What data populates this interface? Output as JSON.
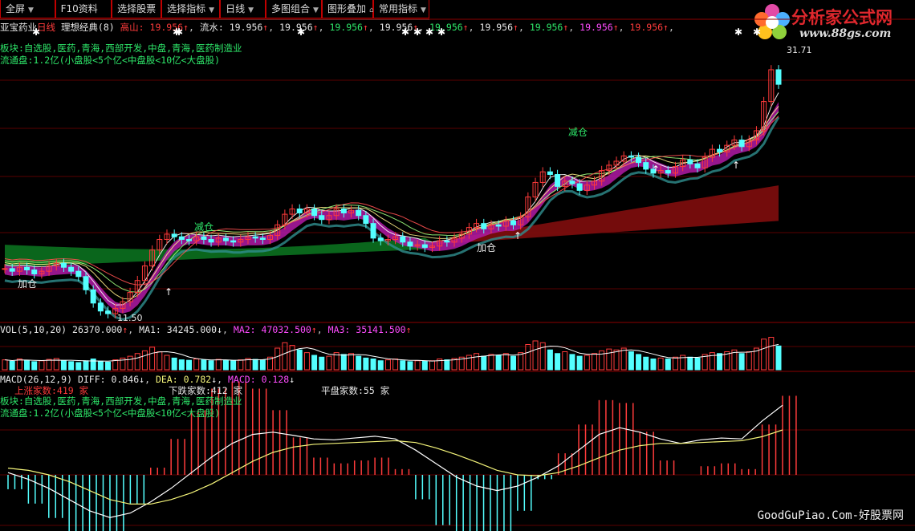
{
  "toolbar": {
    "buttons": [
      "全屏",
      "F10资料",
      "选择股票",
      "选择指标",
      "日线",
      "多图组合",
      "图形叠加",
      "常用指标"
    ]
  },
  "logo": {
    "name": "分析家公式网",
    "url": "www.88gs.com"
  },
  "header": {
    "stock": "亚宝药业",
    "period": "日线",
    "indicator": "理想经典(8)",
    "gaoshan_label": "高山:",
    "gaoshan_value": "19.956",
    "liushui_label": "流水:",
    "liushui_value": "19.956",
    "repeat_value": "19.956"
  },
  "info": {
    "bankuai": "板块:自选股,医药,青海,西部开发,中盘,青海,医药制造业",
    "liutong": "流通盘:1.2亿(小盘股<5个亿<中盘股<10亿<大盘股)"
  },
  "annotations": {
    "jiacang": "加仓",
    "jiancang": "减仓",
    "high_price": "31.71",
    "low_price": "11.50"
  },
  "vol_panel": {
    "label": "VOL(5,10,20)",
    "vol": "26370.000",
    "ma1_label": "MA1:",
    "ma1": "34245.000",
    "ma2_label": "MA2:",
    "ma2": "47032.500",
    "ma3_label": "MA3:",
    "ma3": "35141.500"
  },
  "macd_panel": {
    "label": "MACD(26,12,9)",
    "diff_label": "DIFF:",
    "diff": "0.846",
    "dea_label": "DEA:",
    "dea": "0.782",
    "macd_label": "MACD:",
    "macd": "0.128",
    "up_count": "上涨家数:419 家",
    "down_count": "下跌家数:412 家",
    "flat_count": "平盘家数:55 家"
  },
  "footer": "GoodGuPiao.Com-好股票网",
  "colors": {
    "up": "#ff3b3b",
    "down": "#54ffff",
    "ribbon_purple": "#b01aa6",
    "cloud_green": "#0b6b1e",
    "cloud_red": "#7a0d0d",
    "panel_line": "#8b0000"
  },
  "chart_data": {
    "type": "candlestick",
    "price_range": [
      11.5,
      31.71
    ],
    "high": 31.71,
    "low": 11.5,
    "close": [
      15.2,
      15.0,
      15.3,
      15.1,
      14.8,
      15.0,
      15.4,
      15.6,
      15.3,
      15.0,
      14.6,
      13.6,
      12.6,
      12.0,
      11.8,
      12.2,
      12.7,
      13.4,
      14.3,
      15.4,
      16.6,
      17.4,
      17.8,
      17.6,
      17.4,
      17.3,
      17.6,
      17.4,
      17.2,
      17.5,
      17.3,
      17.2,
      17.4,
      17.6,
      17.5,
      17.4,
      17.7,
      18.5,
      19.3,
      19.7,
      19.4,
      19.7,
      19.2,
      18.9,
      19.2,
      19.7,
      19.4,
      19.6,
      19.2,
      18.6,
      17.5,
      17.3,
      17.4,
      17.6,
      17.2,
      16.9,
      17.0,
      16.8,
      16.9,
      17.3,
      17.2,
      17.5,
      17.8,
      18.3,
      18.6,
      18.2,
      18.5,
      18.4,
      18.8,
      18.5,
      19.1,
      20.6,
      21.7,
      22.5,
      22.3,
      21.4,
      21.8,
      21.6,
      21.1,
      21.5,
      21.8,
      22.6,
      23.0,
      23.3,
      23.7,
      23.6,
      23.2,
      22.7,
      22.4,
      22.6,
      22.4,
      22.9,
      23.4,
      23.1,
      22.8,
      23.6,
      24.2,
      24.0,
      24.5,
      24.9,
      24.4,
      24.9,
      25.6,
      27.8,
      30.2,
      29.1
    ],
    "volume": [
      11000,
      9500,
      12000,
      10500,
      9000,
      10000,
      11500,
      12500,
      10000,
      9000,
      8000,
      10000,
      12000,
      9500,
      8500,
      11000,
      13000,
      15000,
      18000,
      21000,
      25000,
      20000,
      16000,
      13000,
      11000,
      10500,
      12000,
      11000,
      10000,
      11500,
      10500,
      10000,
      11000,
      12500,
      11500,
      11000,
      14000,
      24000,
      30000,
      27000,
      22000,
      19000,
      16000,
      14000,
      15000,
      19000,
      17000,
      18000,
      15000,
      13000,
      12000,
      10000,
      11000,
      12000,
      10000,
      9000,
      10000,
      9500,
      10000,
      12000,
      11000,
      12500,
      14000,
      16000,
      18000,
      15000,
      17000,
      16000,
      18000,
      15000,
      19000,
      28000,
      32000,
      30000,
      22000,
      18000,
      20000,
      17000,
      15000,
      16000,
      18000,
      21000,
      23000,
      22000,
      24000,
      20000,
      17000,
      14000,
      12000,
      13000,
      12000,
      14000,
      16000,
      14000,
      13000,
      17000,
      19000,
      18000,
      20000,
      22000,
      18000,
      20000,
      24000,
      34000,
      36000,
      26370
    ],
    "macd_diff": [
      0.05,
      -0.1,
      -0.3,
      -0.55,
      -0.8,
      -0.95,
      -0.85,
      -0.6,
      -0.3,
      0.05,
      0.4,
      0.7,
      0.9,
      0.95,
      0.88,
      0.8,
      0.78,
      0.82,
      0.86,
      0.8,
      0.55,
      0.25,
      -0.05,
      -0.25,
      -0.35,
      -0.25,
      -0.05,
      0.2,
      0.55,
      0.9,
      1.05,
      0.95,
      0.8,
      0.7,
      0.78,
      0.82,
      0.8,
      1.2,
      1.55
    ],
    "macd_dea": [
      0.15,
      0.1,
      0.0,
      -0.15,
      -0.35,
      -0.55,
      -0.65,
      -0.65,
      -0.55,
      -0.4,
      -0.2,
      0.05,
      0.3,
      0.5,
      0.62,
      0.68,
      0.7,
      0.72,
      0.74,
      0.76,
      0.72,
      0.6,
      0.45,
      0.28,
      0.1,
      0.0,
      -0.02,
      0.05,
      0.2,
      0.38,
      0.55,
      0.65,
      0.7,
      0.7,
      0.72,
      0.74,
      0.76,
      0.85,
      1.0
    ]
  }
}
